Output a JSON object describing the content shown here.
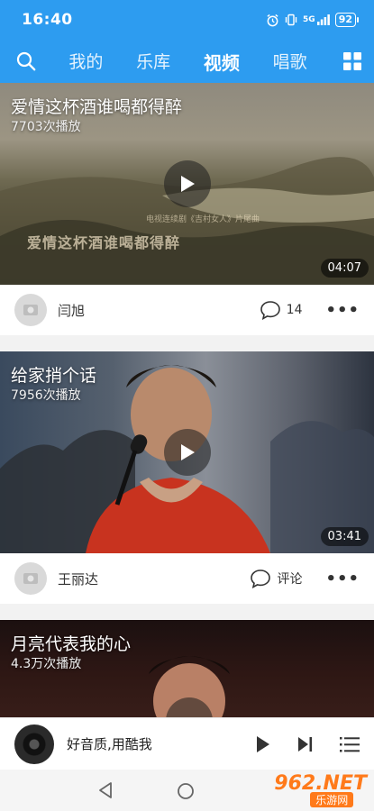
{
  "status": {
    "time": "16:40",
    "signal": "5G",
    "battery": "92"
  },
  "nav": {
    "tabs": [
      {
        "label": "我的"
      },
      {
        "label": "乐库"
      },
      {
        "label": "视频"
      },
      {
        "label": "唱歌"
      }
    ],
    "active_tab": "视频"
  },
  "videos": [
    {
      "title": "爱情这杯酒谁喝都得醉",
      "plays": "7703次播放",
      "duration": "04:07",
      "author": "闫旭",
      "comments": "14",
      "caption": "爱情这杯酒谁喝都得醉",
      "caption_small": "电视连续剧《吉村女人》片尾曲"
    },
    {
      "title": "给家捎个话",
      "plays": "7956次播放",
      "duration": "03:41",
      "author": "王丽达",
      "comments": "评论"
    },
    {
      "title": "月亮代表我的心",
      "plays": "4.3万次播放"
    }
  ],
  "player": {
    "text": "好音质,用酷我"
  },
  "watermark": {
    "big": "962.NET",
    "small": "乐游网"
  },
  "colors": {
    "brand_blue": "#2d9cf0",
    "watermark_orange": "#ff7a1a"
  }
}
